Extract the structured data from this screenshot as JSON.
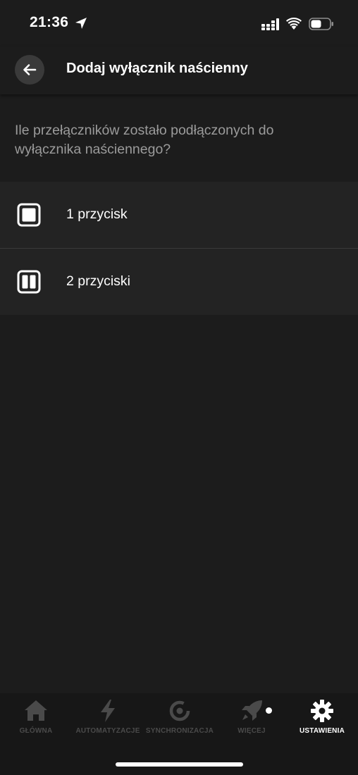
{
  "status_bar": {
    "time": "21:36"
  },
  "header": {
    "title": "Dodaj wyłącznik naścienny"
  },
  "question": "Ile przełączników zostało podłączonych do wyłącznika naściennego?",
  "options": [
    {
      "label": "1 przycisk",
      "icon": "single-button-icon"
    },
    {
      "label": "2 przyciski",
      "icon": "double-button-icon"
    }
  ],
  "bottom_nav": [
    {
      "label": "GŁÓWNA",
      "icon": "home-icon",
      "active": false
    },
    {
      "label": "AUTOMATYZACJE",
      "icon": "lightning-icon",
      "active": false
    },
    {
      "label": "SYNCHRONIZACJA",
      "icon": "sync-icon",
      "active": false
    },
    {
      "label": "WIĘCEJ",
      "icon": "rocket-icon",
      "active": false
    },
    {
      "label": "USTAWIENIA",
      "icon": "gear-icon",
      "active": true
    }
  ],
  "colors": {
    "background": "#1c1c1c",
    "list_bg": "#232323",
    "muted_text": "#9b9b9b",
    "inactive_nav": "#4a4a4a"
  }
}
